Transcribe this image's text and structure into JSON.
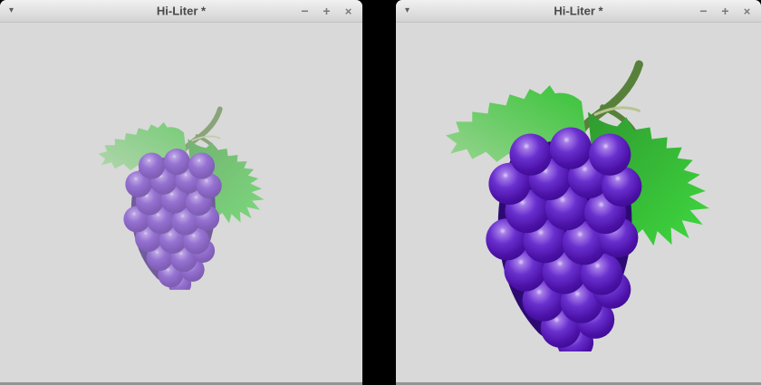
{
  "page": {
    "background": "#000000",
    "description": "Two Hi-Liter app windows showing the same grape illustration at different sizes"
  },
  "windows": [
    {
      "title": "Hi-Liter *",
      "menu_icon": "▾",
      "controls": {
        "minimize": "−",
        "maximize": "+",
        "close": "×"
      },
      "content": {
        "illustration": "grape-bunch-with-leaves",
        "style": "faded-small"
      }
    },
    {
      "title": "Hi-Liter *",
      "menu_icon": "▾",
      "controls": {
        "minimize": "−",
        "maximize": "+",
        "close": "×"
      },
      "content": {
        "illustration": "grape-bunch-with-leaves",
        "style": "vivid-large"
      }
    }
  ],
  "art_colors": {
    "canvas_gray": "#d9d9d9",
    "gap_black": "#000000",
    "grape_dark": "#380989",
    "grape_mid": "#6a30cf",
    "grape_highlight": "#dcd0f8",
    "leaf_green_bright": "#3fd93f",
    "leaf_green_pale": "#9dd595",
    "stem_olive": "#57813a",
    "titlebar_text": "#4a4a4a"
  }
}
